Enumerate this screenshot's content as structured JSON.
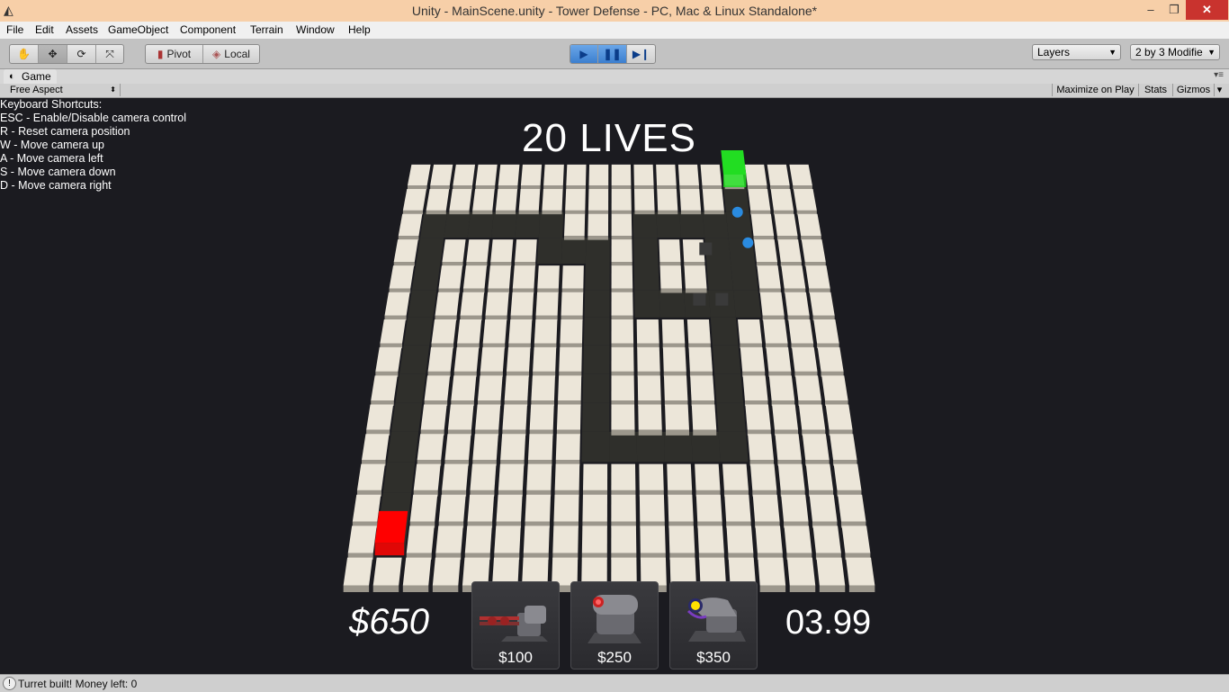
{
  "window": {
    "title": "Unity - MainScene.unity - Tower Defense - PC, Mac & Linux Standalone*",
    "minimize_icon": "minimize-icon",
    "maximize_icon": "restore-icon",
    "close_icon": "close-icon"
  },
  "menu": [
    "File",
    "Edit",
    "Assets",
    "GameObject",
    "Component",
    "Terrain",
    "Window",
    "Help"
  ],
  "toolbar": {
    "pivot_label": "Pivot",
    "local_label": "Local",
    "layers_label": "Layers",
    "layout_label": "2 by 3 Modifie"
  },
  "game_panel": {
    "tab_label": "Game",
    "aspect_label": "Free Aspect",
    "maximize_label": "Maximize on Play",
    "stats_label": "Stats",
    "gizmos_label": "Gizmos"
  },
  "shortcuts": [
    "Keyboard Shortcuts:",
    "ESC - Enable/Disable camera control",
    "R - Reset camera position",
    "W - Move camera up",
    "A - Move camera left",
    "S - Move camera down",
    "D - Move camera right"
  ],
  "hud": {
    "lives": "20 LIVES",
    "money": "$650",
    "timer": "03.99",
    "turrets": [
      {
        "price": "$100",
        "icon": "gatling-turret-icon"
      },
      {
        "price": "$250",
        "icon": "cannon-turret-icon"
      },
      {
        "price": "$350",
        "icon": "laser-turret-icon"
      }
    ]
  },
  "colors": {
    "background": "#1b1b20",
    "tile": "#ece6d9",
    "path": "#2f2f2b",
    "start": "#ff0000",
    "goal": "#22dd22"
  },
  "status": {
    "text": "Turret built! Money left: 0"
  }
}
